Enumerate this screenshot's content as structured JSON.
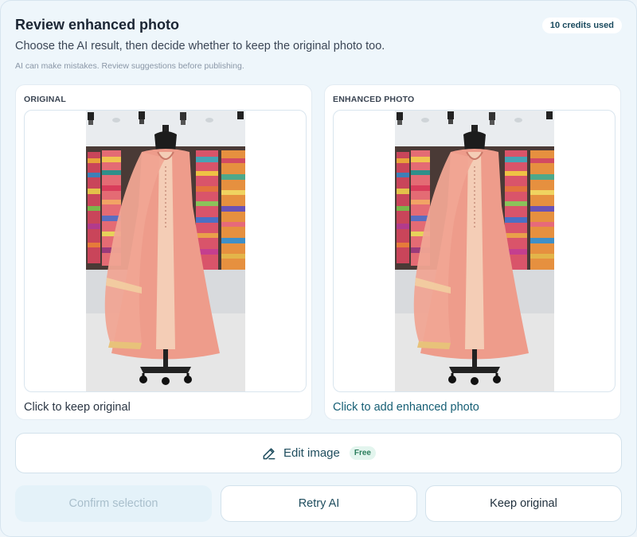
{
  "header": {
    "title": "Review enhanced photo",
    "credits_badge": "10 credits used",
    "subtitle": "Choose the AI result, then decide whether to keep the original photo too.",
    "disclaimer": "AI can make mistakes. Review suggestions before publishing."
  },
  "original": {
    "label": "ORIGINAL",
    "action": "Click to keep original"
  },
  "enhanced": {
    "label": "ENHANCED PHOTO",
    "action": "Click to add enhanced photo"
  },
  "edit": {
    "label": "Edit image",
    "badge": "Free",
    "icon": "pencil-icon"
  },
  "buttons": {
    "confirm": "Confirm selection",
    "retry": "Retry AI",
    "keep": "Keep original"
  },
  "colors": {
    "accent": "#155e74",
    "dress": "#ec9a8a",
    "free_badge_bg": "#e3f5ee"
  }
}
